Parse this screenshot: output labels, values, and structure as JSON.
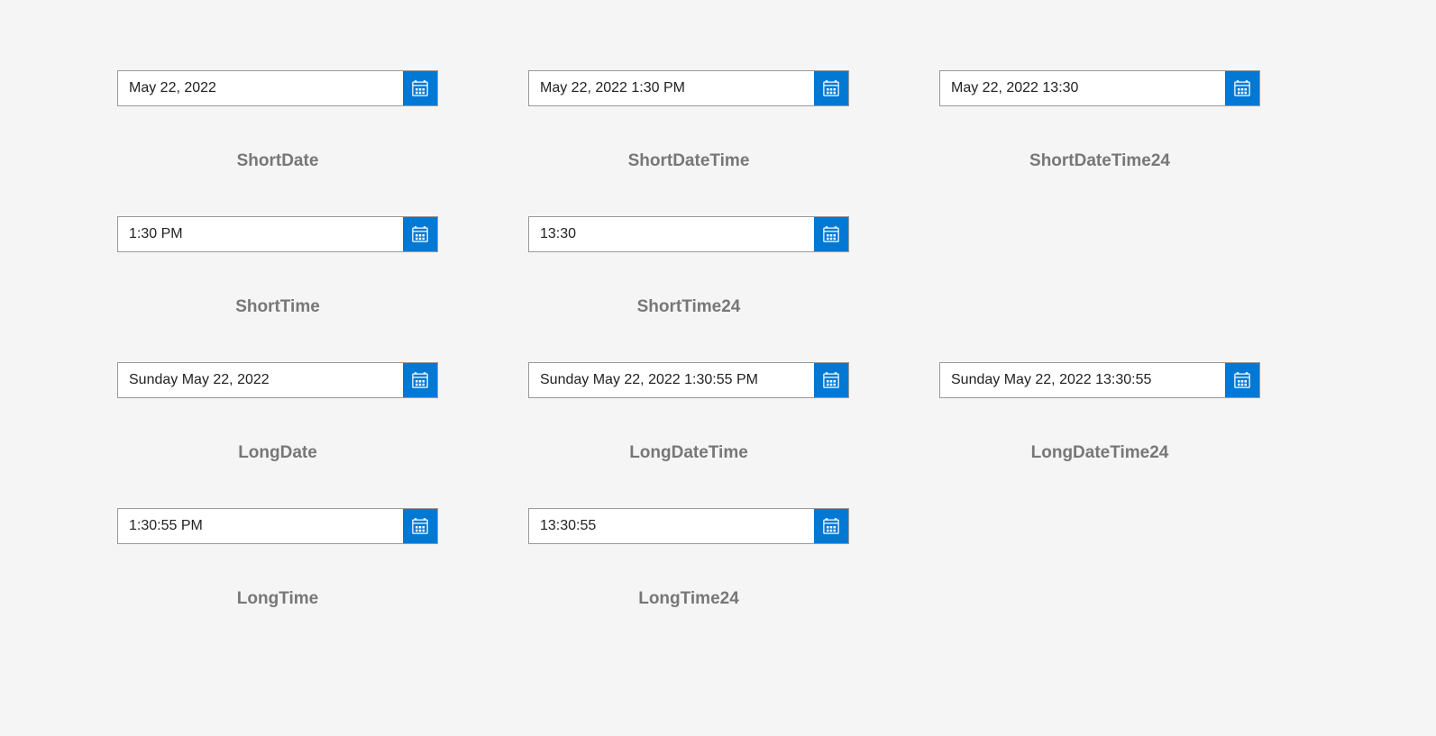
{
  "pickers": {
    "short_date": {
      "value": "May 22, 2022",
      "label": "ShortDate"
    },
    "short_date_time": {
      "value": "May 22, 2022 1:30 PM",
      "label": "ShortDateTime"
    },
    "short_date_time_24": {
      "value": "May 22, 2022 13:30",
      "label": "ShortDateTime24"
    },
    "short_time": {
      "value": "1:30 PM",
      "label": "ShortTime"
    },
    "short_time_24": {
      "value": "13:30",
      "label": "ShortTime24"
    },
    "long_date": {
      "value": "Sunday May 22, 2022",
      "label": "LongDate"
    },
    "long_date_time": {
      "value": "Sunday May 22, 2022 1:30:55 PM",
      "label": "LongDateTime"
    },
    "long_date_time_24": {
      "value": "Sunday May 22, 2022 13:30:55",
      "label": "LongDateTime24"
    },
    "long_time": {
      "value": "1:30:55 PM",
      "label": "LongTime"
    },
    "long_time_24": {
      "value": "13:30:55",
      "label": "LongTime24"
    }
  }
}
